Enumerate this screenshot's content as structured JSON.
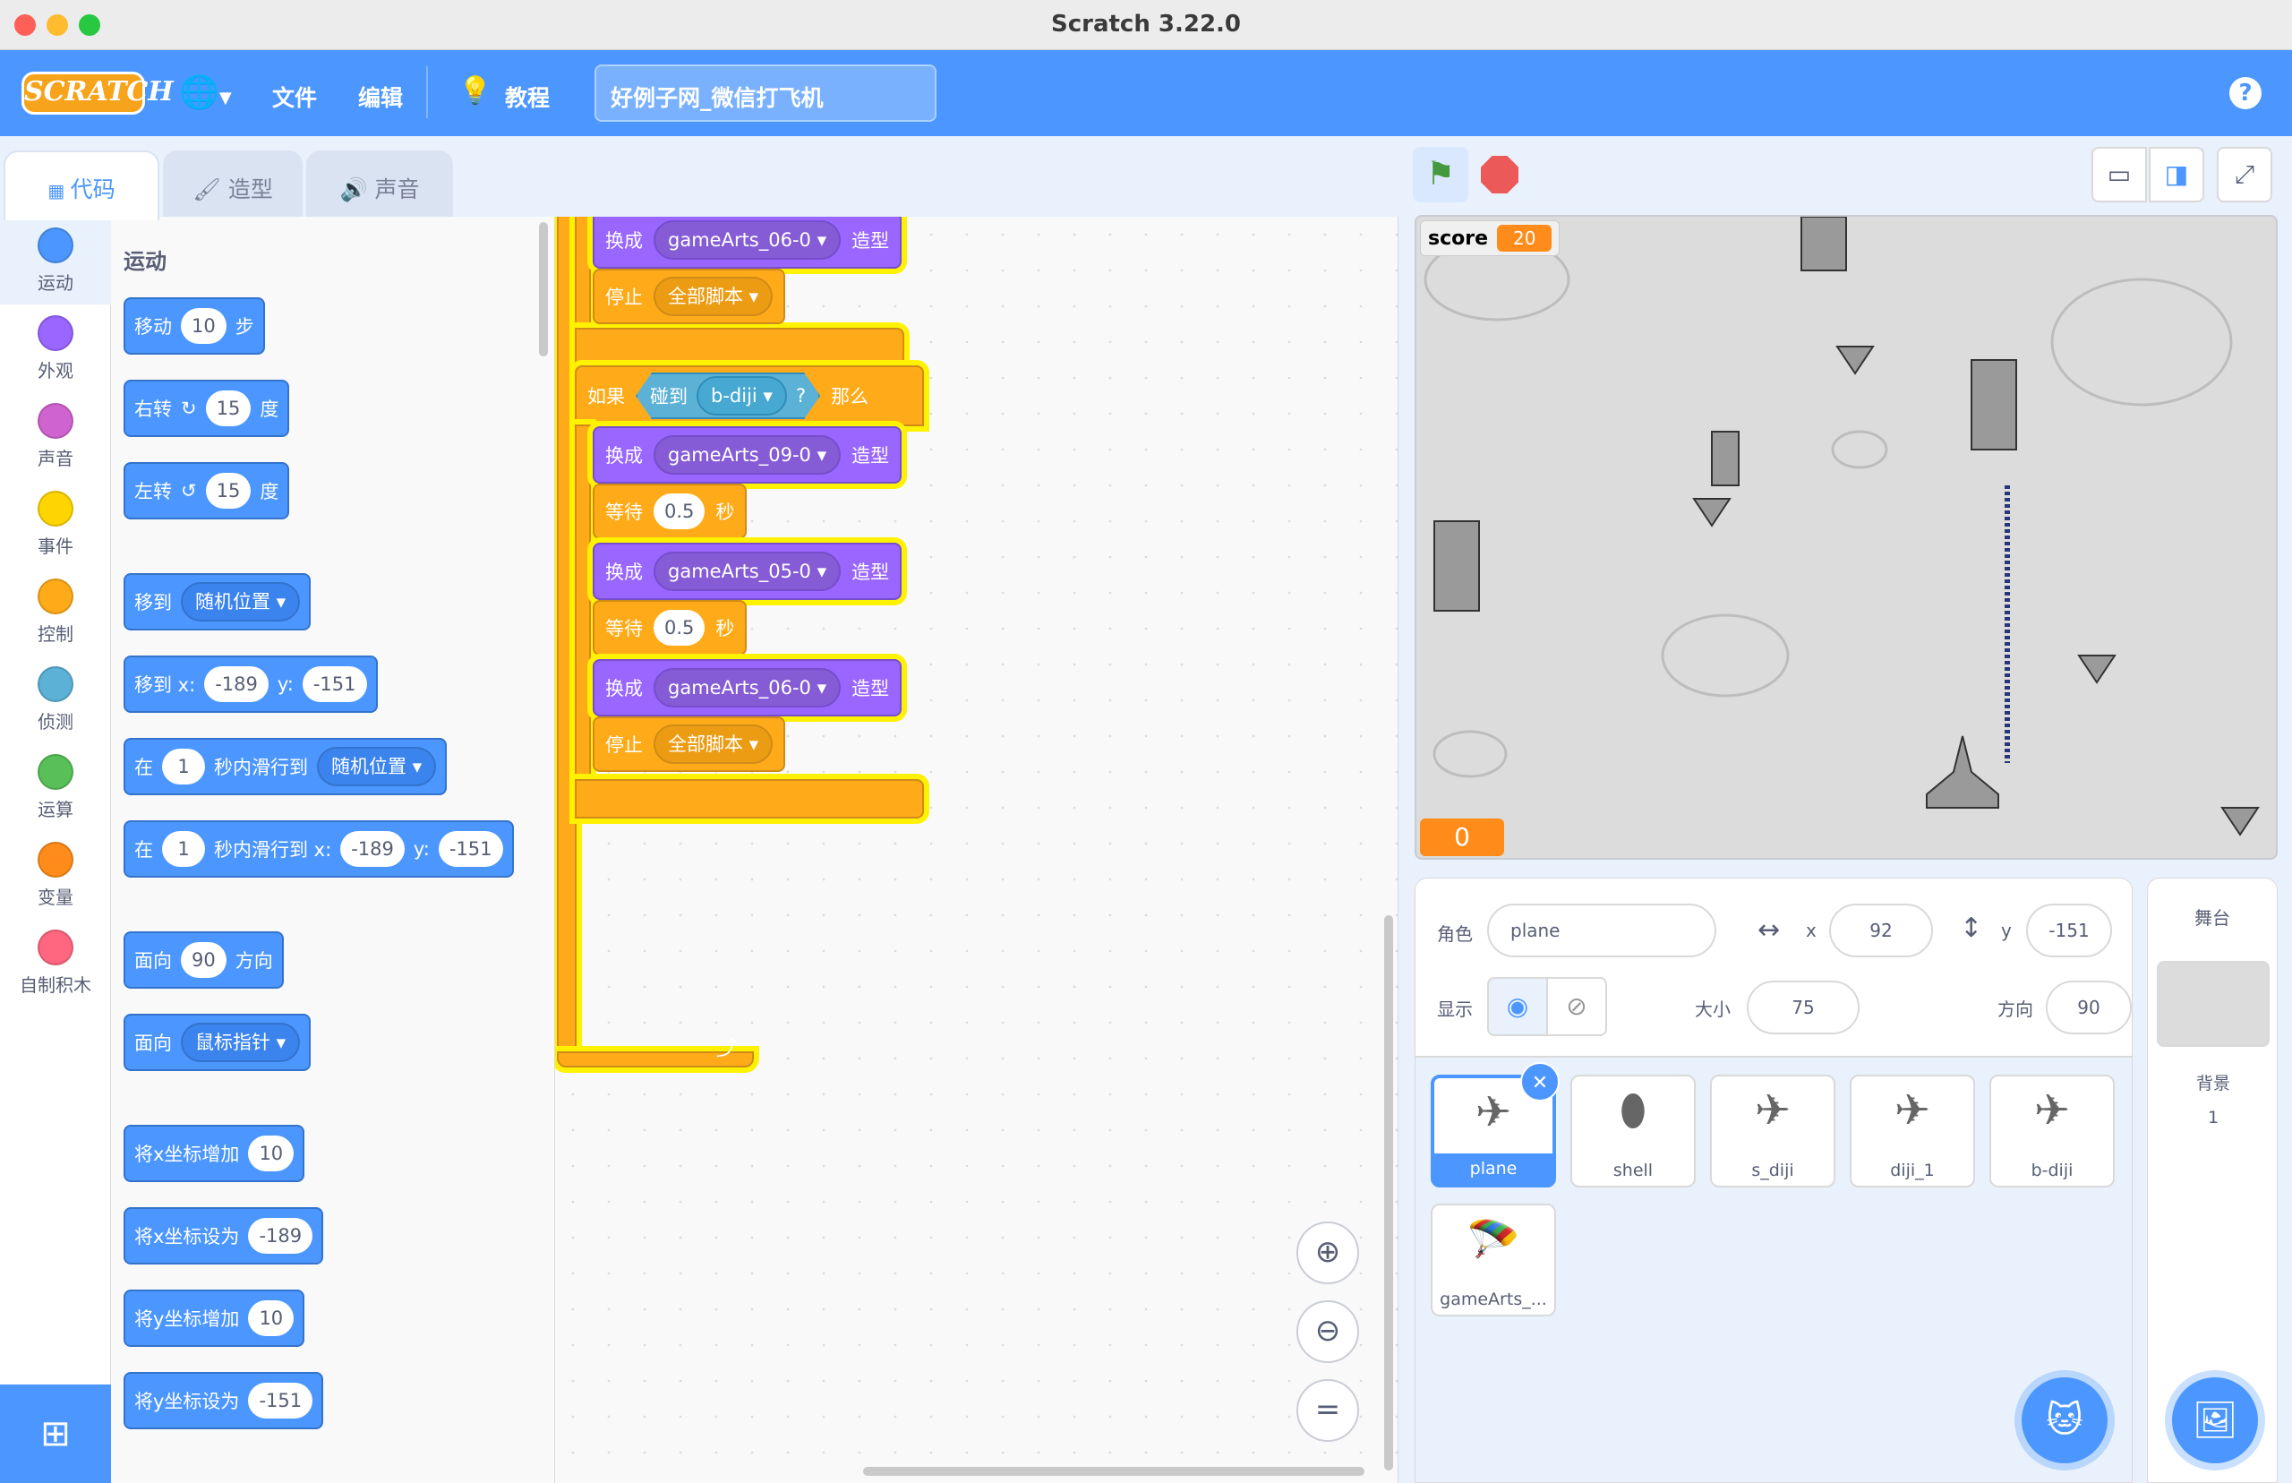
{
  "window": {
    "title": "Scratch 3.22.0"
  },
  "menubar": {
    "logo": "SCRATCH",
    "file": "文件",
    "edit": "编辑",
    "tutorials": "教程",
    "project_title": "好例子网_微信打飞机",
    "help": "?"
  },
  "tabs": {
    "code": "代码",
    "costumes": "造型",
    "sounds": "声音"
  },
  "categories": [
    {
      "label": "运动",
      "color": "#4c97ff"
    },
    {
      "label": "外观",
      "color": "#9966ff"
    },
    {
      "label": "声音",
      "color": "#cf63cf"
    },
    {
      "label": "事件",
      "color": "#ffd500"
    },
    {
      "label": "控制",
      "color": "#ffab19"
    },
    {
      "label": "侦测",
      "color": "#5cb1d6"
    },
    {
      "label": "运算",
      "color": "#59c059"
    },
    {
      "label": "变量",
      "color": "#ff8c1a"
    },
    {
      "label": "自制积木",
      "color": "#ff6680"
    }
  ],
  "palette": {
    "heading": "运动",
    "move": {
      "a": "移动",
      "v": "10",
      "b": "步"
    },
    "turn_right": {
      "a": "右转",
      "v": "15",
      "b": "度"
    },
    "turn_left": {
      "a": "左转",
      "v": "15",
      "b": "度"
    },
    "goto": {
      "a": "移到",
      "d": "随机位置"
    },
    "goto_xy": {
      "a": "移到 x:",
      "x": "-189",
      "b": "y:",
      "y": "-151"
    },
    "glide_random": {
      "a": "在",
      "v": "1",
      "b": "秒内滑行到",
      "d": "随机位置"
    },
    "glide_xy": {
      "a": "在",
      "v": "1",
      "b": "秒内滑行到 x:",
      "x": "-189",
      "c": "y:",
      "y": "-151"
    },
    "point_dir": {
      "a": "面向",
      "v": "90",
      "b": "方向"
    },
    "point_towards": {
      "a": "面向",
      "d": "鼠标指针"
    },
    "change_x": {
      "a": "将x坐标增加",
      "v": "10"
    },
    "set_x": {
      "a": "将x坐标设为",
      "v": "-189"
    },
    "change_y": {
      "a": "将y坐标增加",
      "v": "10"
    },
    "set_y": {
      "a": "将y坐标设为",
      "v": "-151"
    }
  },
  "script": {
    "switch": "换成",
    "costume": "造型",
    "stop": "停止",
    "stop_all": "全部脚本",
    "if": "如果",
    "touching": "碰到",
    "touch_target": "b-diji",
    "q": "?",
    "then": "那么",
    "wait": "等待",
    "sec": "秒",
    "wait_val": "0.5",
    "c1": "gameArts_06-0",
    "c2": "gameArts_09-0",
    "c3": "gameArts_05-0",
    "c4": "gameArts_06-0"
  },
  "stage": {
    "score_label": "score",
    "score_value": "20",
    "counter": "0"
  },
  "sprite_info": {
    "sprite_label": "角色",
    "name": "plane",
    "x_label": "x",
    "x": "92",
    "y_label": "y",
    "y": "-151",
    "show_label": "显示",
    "size_label": "大小",
    "size": "75",
    "direction_label": "方向",
    "direction": "90"
  },
  "sprites": [
    "plane",
    "shell",
    "s_diji",
    "diji_1",
    "b-diji",
    "gameArts_..."
  ],
  "stage_pane": {
    "title": "舞台",
    "backdrop_label": "背景",
    "backdrop_count": "1"
  }
}
